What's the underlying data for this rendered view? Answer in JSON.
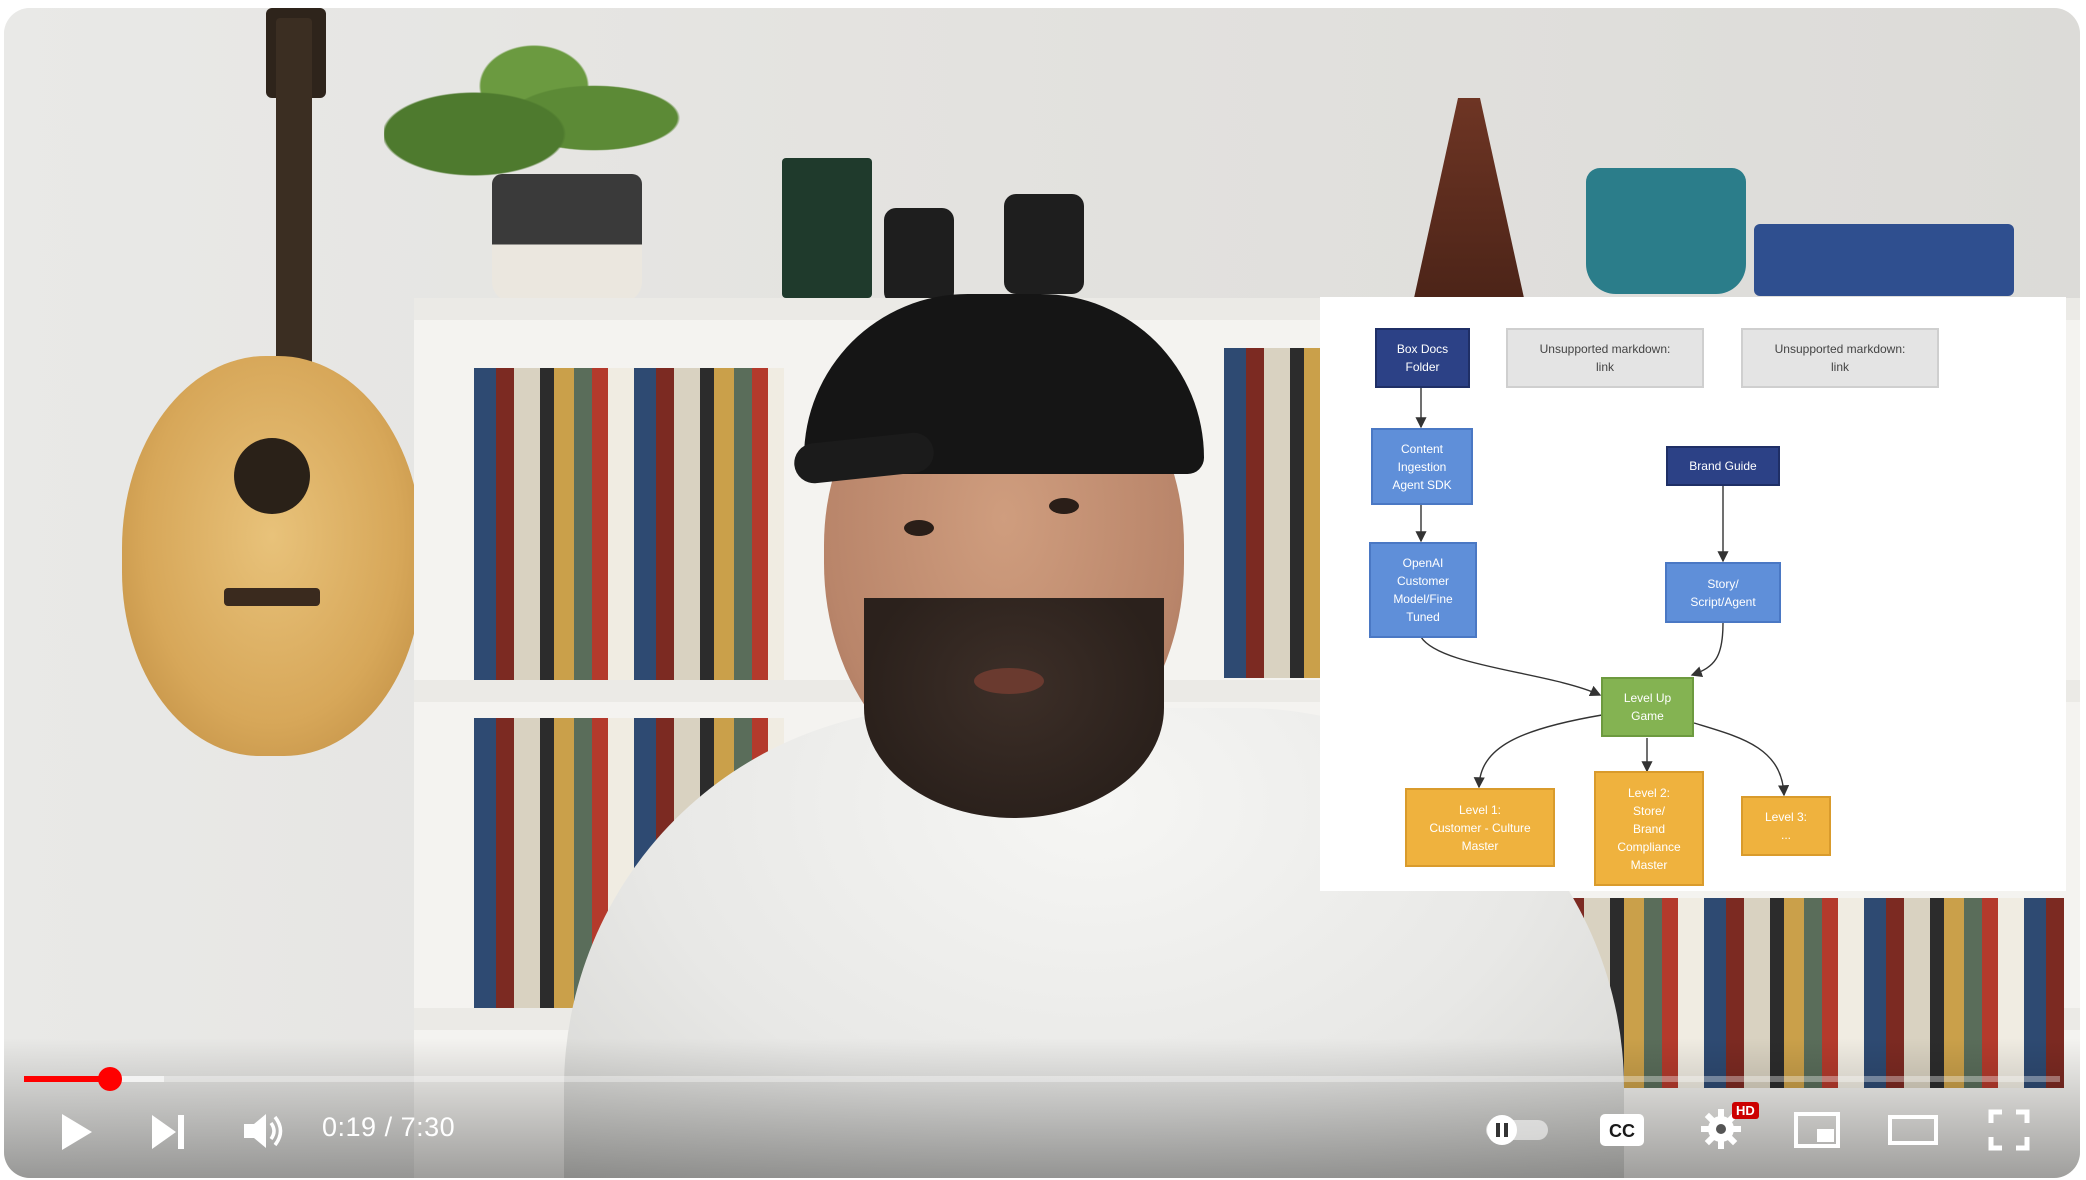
{
  "diagram": {
    "nodes": {
      "box_docs": "Box Docs\nFolder",
      "unsupported_1": "Unsupported markdown:\nlink",
      "unsupported_2": "Unsupported markdown:\nlink",
      "content_ingestion": "Content\nIngestion\nAgent SDK",
      "brand_guide": "Brand Guide",
      "openai_model": "OpenAI\nCustomer\nModel/Fine\nTuned",
      "story_script": "Story/\nScript/Agent",
      "level_up": "Level Up\nGame",
      "level_1": "Level 1:\nCustomer - Culture\nMaster",
      "level_2": "Level 2:\nStore/\nBrand\nCompliance\nMaster",
      "level_3": "Level 3:\n..."
    },
    "colors": {
      "navy": "#2c4186",
      "blue": "#5f8fd9",
      "gray": "#e4e4e4",
      "green": "#84b352",
      "orange": "#efb23e"
    }
  },
  "player": {
    "current_time": "0:19",
    "separator": " / ",
    "duration": "7:30",
    "progress_played_fraction": 0.042,
    "progress_buffered_fraction": 0.069,
    "hd_badge": "HD",
    "accent_color": "#ff0000",
    "icons": [
      "play-icon",
      "next-icon",
      "volume-icon",
      "autoplay-toggle-icon",
      "captions-icon",
      "settings-icon",
      "miniplayer-icon",
      "theater-icon",
      "fullscreen-icon"
    ]
  }
}
